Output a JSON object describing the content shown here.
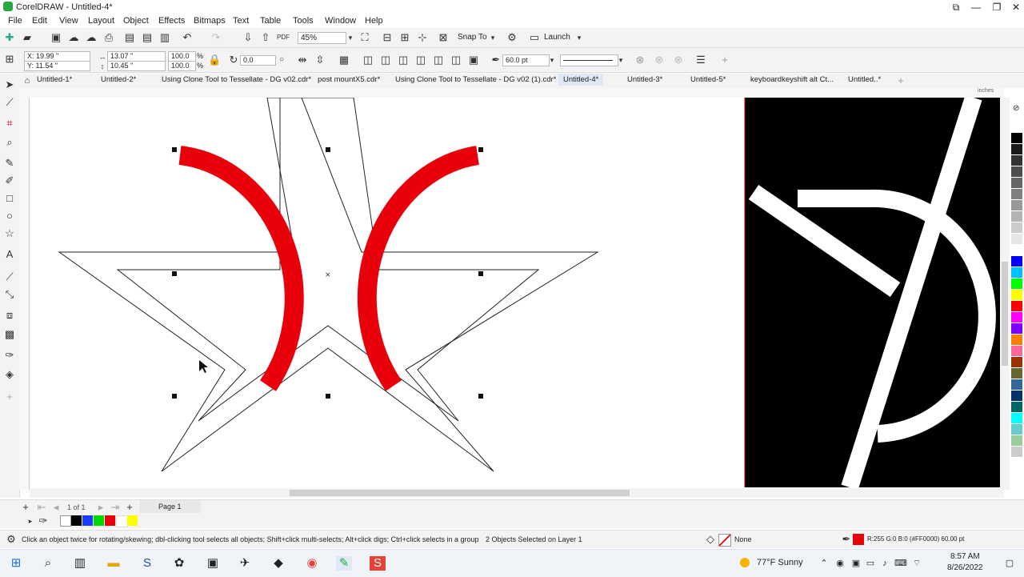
{
  "app": {
    "title": "CorelDRAW - Untitled-4*"
  },
  "menu": [
    "File",
    "Edit",
    "View",
    "Layout",
    "Object",
    "Effects",
    "Bitmaps",
    "Text",
    "Table",
    "Tools",
    "Window",
    "Help"
  ],
  "std_toolbar": {
    "zoom": "45%",
    "snap_label": "Snap To",
    "launch_label": "Launch"
  },
  "prop_bar": {
    "x": "X: 19.99 \"",
    "y": "Y: 11.54 \"",
    "w": "13.07 \"",
    "h": "10.45 \"",
    "sx": "100.0",
    "sy": "100.0",
    "pct": "%",
    "angle": "0.0",
    "outline_width": "60.0 pt"
  },
  "tabs": [
    {
      "label": "Untitled-1*"
    },
    {
      "label": "Untitled-2*"
    },
    {
      "label": "Using Clone Tool to Tessellate - DG v02.cdr*"
    },
    {
      "label": "post mountX5.cdr*"
    },
    {
      "label": "Using Clone Tool to Tessellate - DG v02 (1).cdr*"
    },
    {
      "label": "Untitled-4*"
    },
    {
      "label": "Untitled-3*"
    },
    {
      "label": "Untitled-5*"
    },
    {
      "label": "keyboardkeyshift alt Ct..."
    },
    {
      "label": "Untitled..*"
    }
  ],
  "ruler": {
    "unit": "inches"
  },
  "page_nav": {
    "count": "1 of 1",
    "page_tab": "Page 1"
  },
  "status": {
    "hint": "Click an object twice for rotating/skewing; dbl-clicking tool selects all objects; Shift+click multi-selects; Alt+click digs; Ctrl+click selects in a group",
    "selection": "2 Objects Selected on Layer 1",
    "fill": "None",
    "outline": "R:255 G:0 B:0 (#FF0000)  60.00 pt"
  },
  "taskbar": {
    "weather": "77°F  Sunny",
    "time": "8:57 AM",
    "date": "8/26/2022"
  },
  "colors": {
    "accent_red": "#e8000b",
    "palette": [
      "#ffffff",
      "#000000",
      "#1a1a1a",
      "#333333",
      "#4d4d4d",
      "#666666",
      "#808080",
      "#999999",
      "#b3b3b3",
      "#cccccc",
      "#e6e6e6",
      "#ffffff",
      "#0000ff",
      "#00c0ff",
      "#00ff00",
      "#ffff00",
      "#ff0000",
      "#ff00ff",
      "#8000ff",
      "#ff8000",
      "#ff6699",
      "#993300",
      "#666633",
      "#336699",
      "#003366",
      "#006666",
      "#00ffff",
      "#66cccc",
      "#99cc99",
      "#cccccc"
    ]
  }
}
